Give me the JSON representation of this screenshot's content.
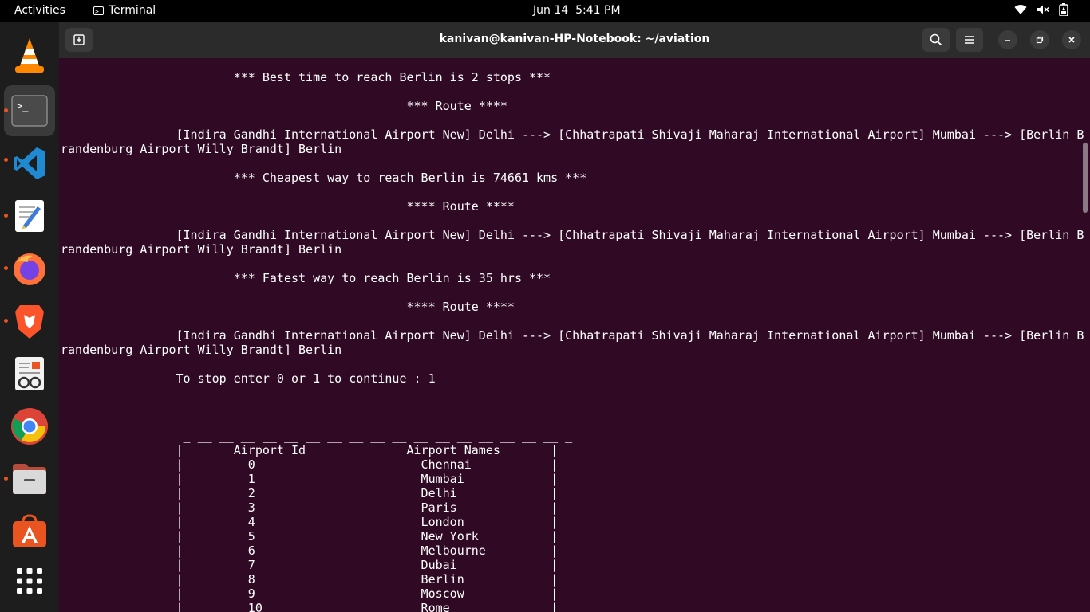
{
  "topbar": {
    "activities": "Activities",
    "app_name": "Terminal",
    "date": "Jun 14",
    "time": "5:41 PM"
  },
  "dock": {
    "items": [
      {
        "name": "vlc-icon"
      },
      {
        "name": "terminal-icon"
      },
      {
        "name": "vscode-icon"
      },
      {
        "name": "text-editor-icon"
      },
      {
        "name": "firefox-icon"
      },
      {
        "name": "brave-icon"
      },
      {
        "name": "document-viewer-icon"
      },
      {
        "name": "chrome-icon"
      },
      {
        "name": "files-icon"
      },
      {
        "name": "app-center-icon"
      },
      {
        "name": "show-apps-icon"
      }
    ]
  },
  "window": {
    "title": "kanivan@kanivan-HP-Notebook: ~/aviation"
  },
  "terminal": {
    "lines": [
      "                        *** Best time to reach Berlin is 2 stops ***",
      "",
      "                                                *** Route ****",
      "",
      "                [Indira Gandhi International Airport New] Delhi ---> [Chhatrapati Shivaji Maharaj International Airport] Mumbai ---> [Berlin B",
      "randenburg Airport Willy Brandt] Berlin",
      "",
      "                        *** Cheapest way to reach Berlin is 74661 kms ***",
      "",
      "                                                **** Route ****",
      "",
      "                [Indira Gandhi International Airport New] Delhi ---> [Chhatrapati Shivaji Maharaj International Airport] Mumbai ---> [Berlin B",
      "randenburg Airport Willy Brandt] Berlin",
      "",
      "                        *** Fatest way to reach Berlin is 35 hrs ***",
      "",
      "                                                **** Route ****",
      "",
      "                [Indira Gandhi International Airport New] Delhi ---> [Chhatrapati Shivaji Maharaj International Airport] Mumbai ---> [Berlin B",
      "randenburg Airport Willy Brandt] Berlin",
      "",
      "                To stop enter 0 or 1 to continue : 1",
      "",
      "",
      "",
      "                 _ __ __ __ __ __ __ __ __ __ __ __ __ __ __ __ __ __ _",
      "                |       Airport Id              Airport Names       |",
      "                |         0                       Chennai           |",
      "                |         1                       Mumbai            |",
      "                |         2                       Delhi             |",
      "                |         3                       Paris             |",
      "                |         4                       London            |",
      "                |         5                       New York          |",
      "                |         6                       Melbourne         |",
      "                |         7                       Dubai             |",
      "                |         8                       Berlin            |",
      "                |         9                       Moscow            |",
      "                |         10                      Rome              |"
    ]
  }
}
